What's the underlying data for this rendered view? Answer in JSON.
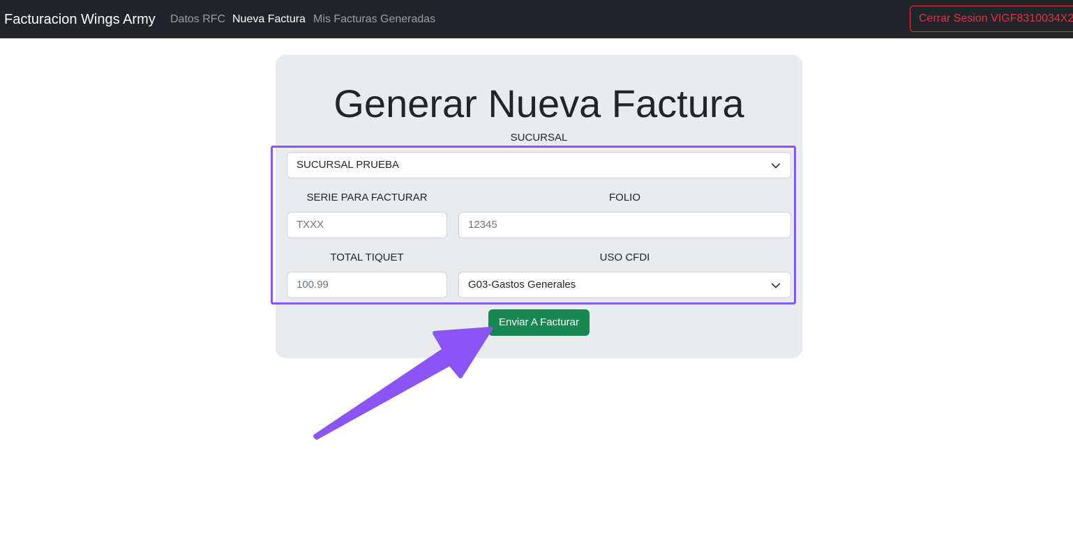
{
  "navbar": {
    "brand": "Facturacion Wings Army",
    "links": [
      {
        "label": "Datos RFC",
        "active": false
      },
      {
        "label": "Nueva Factura",
        "active": true
      },
      {
        "label": "Mis Facturas Generadas",
        "active": false
      }
    ],
    "logout_label": "Cerrar Sesion VIGF8310034X2"
  },
  "form": {
    "title": "Generar Nueva Factura",
    "sucursal": {
      "label": "SUCURSAL",
      "selected": "SUCURSAL PRUEBA"
    },
    "serie": {
      "label": "SERIE PARA FACTURAR",
      "placeholder": "TXXX"
    },
    "folio": {
      "label": "FOLIO",
      "placeholder": "12345"
    },
    "total": {
      "label": "TOTAL TIQUET",
      "placeholder": "100.99"
    },
    "uso_cfdi": {
      "label": "USO CFDI",
      "selected": "G03-Gastos Generales"
    },
    "submit_label": "Enviar A Facturar"
  },
  "colors": {
    "navbar_bg": "#212529",
    "card_bg": "#e9ecef",
    "submit_bg": "#198754",
    "logout": "#dc3545",
    "annotation": "#8b55f6"
  },
  "icons": {
    "select_chevron": "chevron-down-icon",
    "annotation_arrow": "arrow-icon"
  }
}
